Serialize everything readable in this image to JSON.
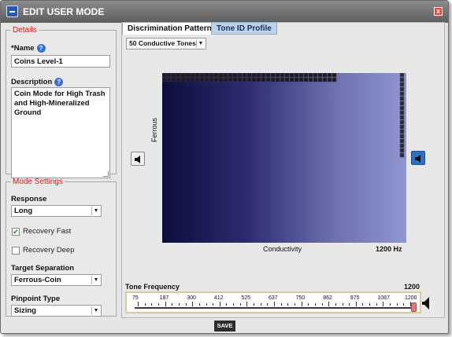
{
  "window": {
    "title": "EDIT USER MODE",
    "close_label": "x"
  },
  "details": {
    "legend": "Details",
    "name_label": "*Name",
    "name_value": "Coins Level-1",
    "description_label": "Description",
    "description_value": "Coin Mode for High Trash and High-Mineralized Ground"
  },
  "mode_settings": {
    "legend": "Mode Settings",
    "response_label": "Response",
    "response_value": "Long",
    "recovery_fast_label": "Recovery Fast",
    "recovery_fast_checked": true,
    "recovery_deep_label": "Recovery Deep",
    "recovery_deep_checked": false,
    "target_sep_label": "Target Separation",
    "target_sep_value": "Ferrous-Coin",
    "pinpoint_label": "Pinpoint Type",
    "pinpoint_value": "Sizing"
  },
  "tabs": [
    {
      "label": "Discrimination Pattern",
      "active": true
    },
    {
      "label": "Tone ID Profile",
      "active": false
    }
  ],
  "tones_select": "50 Conductive Tones",
  "graph": {
    "y_label": "Ferrous",
    "x_label": "Conductivity",
    "x_max_label": "1200 Hz",
    "colors": {
      "dark": "#0c0c3c",
      "light": "#8f96d0"
    }
  },
  "tone_frequency": {
    "label": "Tone Frequency",
    "value": "1200",
    "ticks": [
      "75",
      "187",
      "300",
      "412",
      "525",
      "637",
      "750",
      "862",
      "975",
      "1087",
      "1200"
    ]
  },
  "save_label": "SAVE"
}
